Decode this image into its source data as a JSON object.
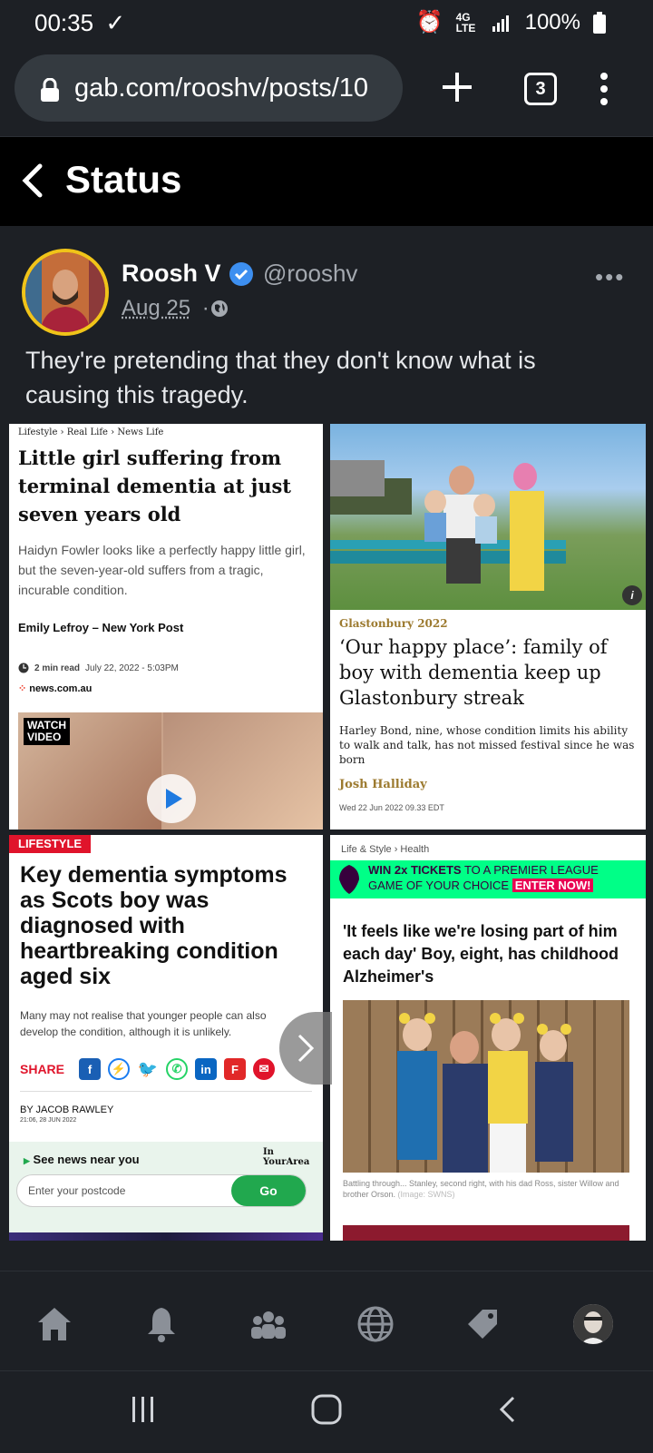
{
  "status_bar": {
    "time": "00:35",
    "network": "4G LTE",
    "battery": "100%"
  },
  "browser": {
    "url": "gab.com/rooshv/posts/10",
    "tab_count": "3"
  },
  "header": {
    "title": "Status"
  },
  "post": {
    "author": "Roosh V",
    "handle": "@rooshv",
    "date": "Aug 25",
    "separator": "·",
    "more": "•••",
    "text": "They're pretending that they don't know what is causing this tragedy."
  },
  "cards": {
    "c1": {
      "crumb1": "Lifestyle",
      "crumb2": "Real Life",
      "crumb3": "News Life",
      "headline": "Little girl suffering from terminal dementia at just seven years old",
      "subhead": "Haidyn Fowler looks like a perfectly happy little girl, but the seven-year-old suffers from a tragic, incurable condition.",
      "author": "Emily Lefroy – New York Post",
      "read_time": "2 min read",
      "date": "July 22, 2022 - 5:03PM",
      "source": "news.com.au",
      "video_label_1": "WATCH",
      "video_label_2": "VIDEO"
    },
    "c2": {
      "kicker": "Glastonbury 2022",
      "headline": "‘Our happy place’: family of boy with dementia keep up Glastonbury streak",
      "subhead": "Harley Bond, nine, whose condition limits his ability to walk and talk, has not missed festival since he was born",
      "author": "Josh Halliday",
      "date": "Wed 22 Jun 2022 09.33 EDT",
      "info": "i"
    },
    "c3": {
      "tag": "LIFESTYLE",
      "headline": "Key dementia symptoms as Scots boy was diagnosed with heartbreaking condition aged six",
      "subhead": "Many may not realise that younger people can also develop the condition, although it is unlikely.",
      "share": "SHARE",
      "byline": "BY JACOB RAWLEY",
      "bydate": "21:06, 28 JUN 2022",
      "near_label": "See news near you",
      "near_logo_1": "In",
      "near_logo_2": "YourArea",
      "postcode_placeholder": "Enter your postcode",
      "go": "Go"
    },
    "c4": {
      "crumb1": "Life & Style",
      "crumb2": "Health",
      "ad_line1_a": "WIN 2x TICKETS",
      "ad_line1_b": "TO A PREMIER LEAGUE",
      "ad_line2_a": "GAME OF YOUR CHOICE",
      "ad_line2_b": "ENTER NOW!",
      "headline": "'It feels like we're losing part of him each day' Boy, eight, has childhood Alzheimer's",
      "caption": "Battling through... Stanley, second right, with his dad Ross, sister Willow and brother Orson.",
      "caption_credit": "(Image: SWNS)"
    }
  },
  "nav": {
    "items": [
      "home-icon",
      "bell-icon",
      "groups-icon",
      "explore-globe-icon",
      "tags-icon",
      "profile-avatar"
    ]
  },
  "colors": {
    "background": "#1d2025",
    "verified": "#3d8ff0",
    "avatar_ring": "#f0c419",
    "go_button": "#21a84e"
  }
}
